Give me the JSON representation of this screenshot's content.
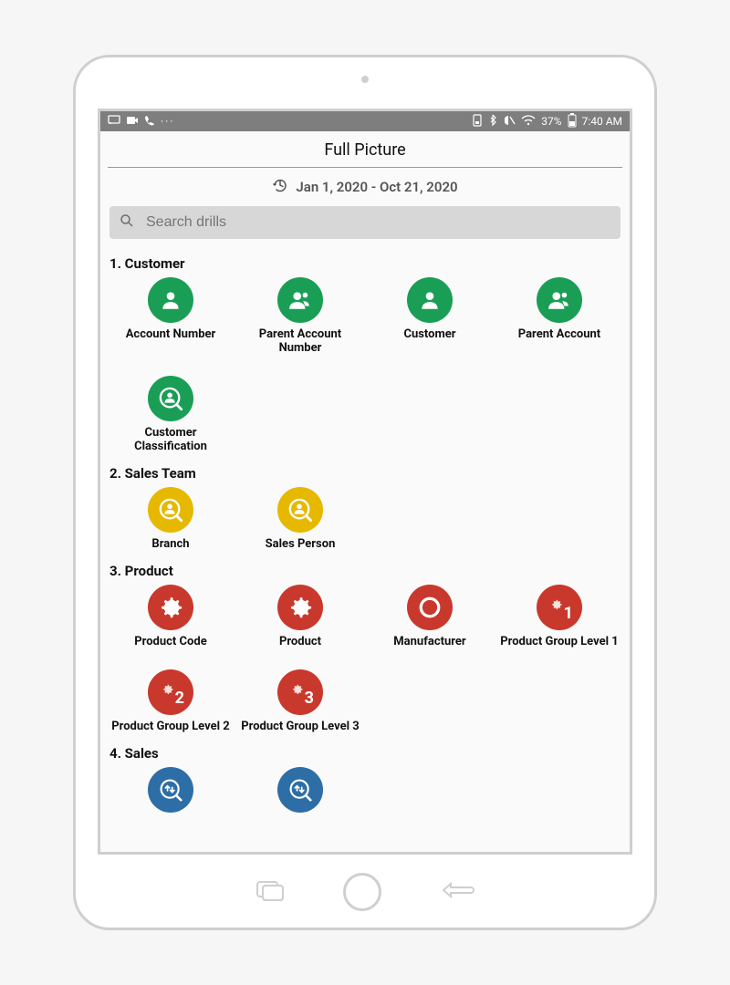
{
  "statusbar": {
    "battery_text": "37%",
    "time_text": "7:40 AM"
  },
  "header": {
    "title": "Full Picture",
    "date_range": "Jan 1, 2020 - Oct 21, 2020"
  },
  "search": {
    "placeholder": "Search drills"
  },
  "colors": {
    "green": "#1a9e55",
    "yellow": "#e6b800",
    "red": "#c9382c",
    "blue": "#2d6ea6"
  },
  "sections": [
    {
      "id": "customer",
      "title": "1. Customer",
      "items": [
        {
          "label": "Account Number",
          "icon": "user",
          "color": "green"
        },
        {
          "label": "Parent Account Number",
          "icon": "users",
          "color": "green"
        },
        {
          "label": "Customer",
          "icon": "user",
          "color": "green"
        },
        {
          "label": "Parent Account",
          "icon": "users",
          "color": "green"
        },
        {
          "label": "Customer Classification",
          "icon": "user-mag",
          "color": "green"
        }
      ]
    },
    {
      "id": "sales-team",
      "title": "2. Sales Team",
      "items": [
        {
          "label": "Branch",
          "icon": "user-mag",
          "color": "yellow"
        },
        {
          "label": "Sales Person",
          "icon": "user-mag",
          "color": "yellow"
        }
      ]
    },
    {
      "id": "product",
      "title": "3. Product",
      "items": [
        {
          "label": "Product Code",
          "icon": "gear",
          "color": "red"
        },
        {
          "label": "Product",
          "icon": "gear",
          "color": "red"
        },
        {
          "label": "Manufacturer",
          "icon": "ring",
          "color": "red"
        },
        {
          "label": "Product Group Level 1",
          "icon": "gearN",
          "color": "red",
          "num": "1"
        },
        {
          "label": "Product Group Level 2",
          "icon": "gearN",
          "color": "red",
          "num": "2"
        },
        {
          "label": "Product Group Level 3",
          "icon": "gearN",
          "color": "red",
          "num": "3"
        }
      ]
    },
    {
      "id": "sales",
      "title": "4. Sales",
      "items": [
        {
          "label": "",
          "icon": "updown-mag",
          "color": "blue"
        },
        {
          "label": "",
          "icon": "updown-mag",
          "color": "blue"
        }
      ]
    }
  ]
}
